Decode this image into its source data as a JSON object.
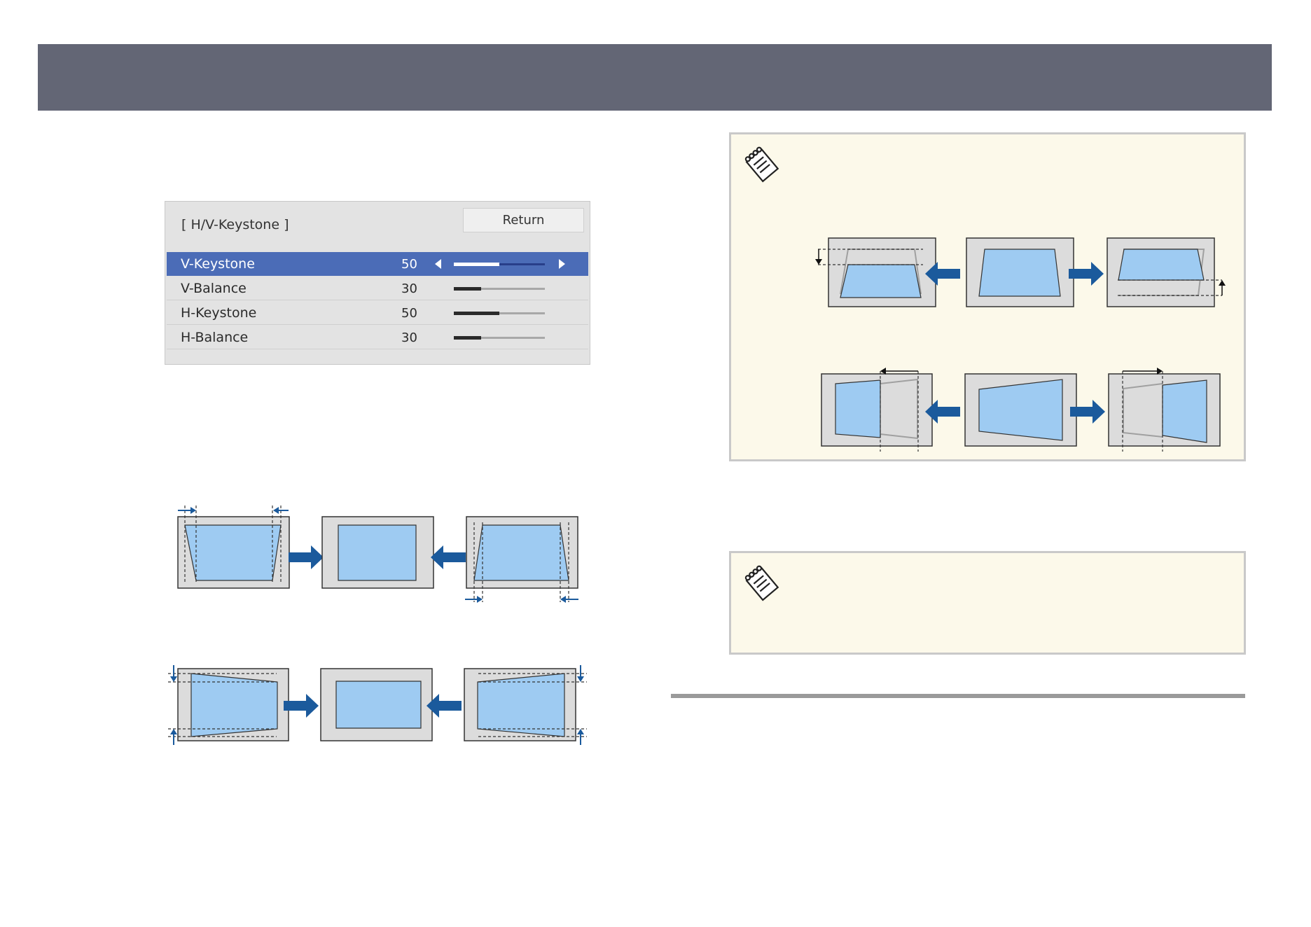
{
  "menu": {
    "title": "[ H/V-Keystone ]",
    "return_label": "Return",
    "rows": [
      {
        "label": "V-Keystone",
        "value": "50",
        "level": 0.5,
        "selected": true
      },
      {
        "label": "V-Balance",
        "value": "30",
        "level": 0.3,
        "selected": false
      },
      {
        "label": "H-Keystone",
        "value": "50",
        "level": 0.5,
        "selected": false
      },
      {
        "label": "H-Balance",
        "value": "30",
        "level": 0.3,
        "selected": false
      }
    ]
  },
  "icons": {
    "note": "note-pad-icon",
    "arrows": "blue-direction-arrow-icon"
  },
  "colors": {
    "header_bar": "#636675",
    "selected_row": "#4b6cb7",
    "note_background": "#fcf9ea",
    "screen_fill": "#9ecbf2",
    "arrow": "#1b5a9c"
  }
}
